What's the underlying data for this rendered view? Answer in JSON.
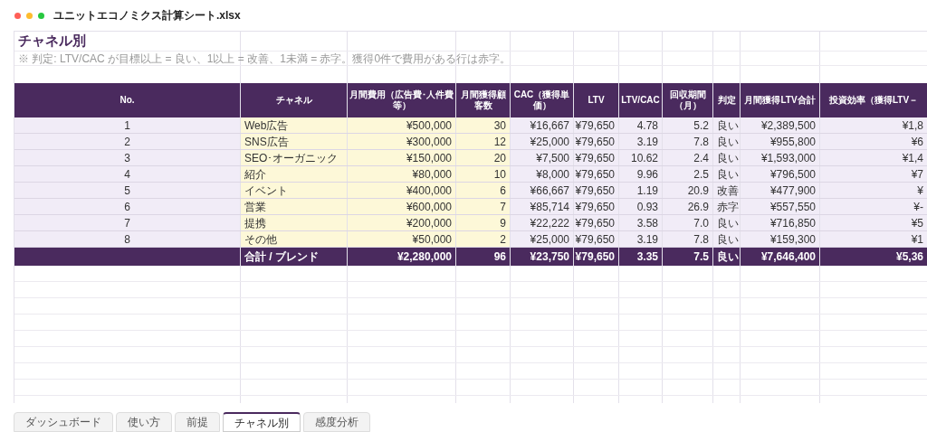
{
  "window": {
    "title": "ユニットエコノミクス計算シート.xlsx"
  },
  "sheet": {
    "title": "チャネル別",
    "note": "※ 判定: LTV/CAC が目標以上 = 良い、1以上 = 改善、1未満 = 赤字。獲得0件で費用がある行は赤字。"
  },
  "table": {
    "columns": [
      "No.",
      "チャネル",
      "月間費用（広告費･人件費等）",
      "月間獲得顧客数",
      "CAC（獲得単価）",
      "LTV",
      "LTV/CAC",
      "回収期間（月）",
      "判定",
      "月間獲得LTV合計",
      "投資効率（獲得LTV－"
    ],
    "rows": [
      [
        "1",
        "Web広告",
        "¥500,000",
        "30",
        "¥16,667",
        "¥79,650",
        "4.78",
        "5.2",
        "良い",
        "¥2,389,500",
        "¥1,8"
      ],
      [
        "2",
        "SNS広告",
        "¥300,000",
        "12",
        "¥25,000",
        "¥79,650",
        "3.19",
        "7.8",
        "良い",
        "¥955,800",
        "¥6"
      ],
      [
        "3",
        "SEO･オーガニック",
        "¥150,000",
        "20",
        "¥7,500",
        "¥79,650",
        "10.62",
        "2.4",
        "良い",
        "¥1,593,000",
        "¥1,4"
      ],
      [
        "4",
        "紹介",
        "¥80,000",
        "10",
        "¥8,000",
        "¥79,650",
        "9.96",
        "2.5",
        "良い",
        "¥796,500",
        "¥7"
      ],
      [
        "5",
        "イベント",
        "¥400,000",
        "6",
        "¥66,667",
        "¥79,650",
        "1.19",
        "20.9",
        "改善",
        "¥477,900",
        "¥"
      ],
      [
        "6",
        "営業",
        "¥600,000",
        "7",
        "¥85,714",
        "¥79,650",
        "0.93",
        "26.9",
        "赤字",
        "¥557,550",
        "¥-"
      ],
      [
        "7",
        "提携",
        "¥200,000",
        "9",
        "¥22,222",
        "¥79,650",
        "3.58",
        "7.0",
        "良い",
        "¥716,850",
        "¥5"
      ],
      [
        "8",
        "その他",
        "¥50,000",
        "2",
        "¥25,000",
        "¥79,650",
        "3.19",
        "7.8",
        "良い",
        "¥159,300",
        "¥1"
      ]
    ],
    "total": [
      "合計 / ブレンド",
      "¥2,280,000",
      "96",
      "¥23,750",
      "¥79,650",
      "3.35",
      "7.5",
      "良い",
      "¥7,646,400",
      "¥5,36"
    ]
  },
  "tabs": [
    {
      "label": "ダッシュボード",
      "selected": false
    },
    {
      "label": "使い方",
      "selected": false
    },
    {
      "label": "前提",
      "selected": false
    },
    {
      "label": "チャネル別",
      "selected": true
    },
    {
      "label": "感度分析",
      "selected": false
    }
  ]
}
